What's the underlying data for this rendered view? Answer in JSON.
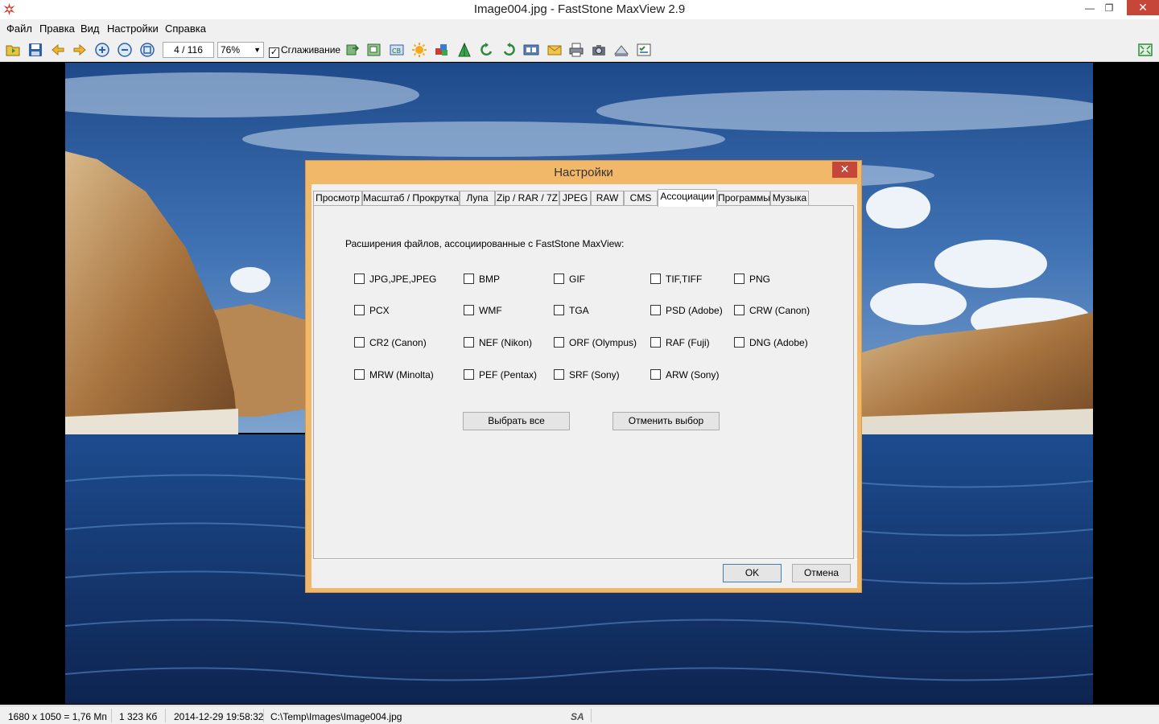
{
  "window": {
    "title": "Image004.jpg - FastStone MaxView 2.9",
    "min_glyph": "—",
    "max_glyph": "❐",
    "close_glyph": "✕"
  },
  "menu": {
    "items": [
      "Файл",
      "Правка",
      "Вид",
      "Настройки",
      "Справка"
    ]
  },
  "toolbar": {
    "page_counter": "4 / 116",
    "zoom_value": "76%",
    "smoothing_label": "Сглаживание",
    "smoothing_checked": true,
    "checkmark": "✓",
    "caret": "▼",
    "icons": [
      "open-folder-icon",
      "save-icon",
      "previous-icon",
      "next-icon",
      "zoom-in-icon",
      "zoom-out-icon",
      "actual-size-icon",
      "copy-to-icon",
      "resize-icon",
      "crop-icon",
      "brightness-icon",
      "colors-icon",
      "sharpen-icon",
      "rotate-left-icon",
      "rotate-right-icon",
      "slideshow-icon",
      "email-icon",
      "print-icon",
      "capture-icon",
      "wallpaper-icon",
      "properties-icon",
      "fit-screen-icon"
    ]
  },
  "status": {
    "dimensions": "1680 x 1050 = 1,76 Мп",
    "filesize": "1 323 Кб",
    "datetime": "2014-12-29 19:58:32",
    "path": "C:\\Temp\\Images\\Image004.jpg",
    "badge": "SA"
  },
  "dialog": {
    "title": "Настройки",
    "close_glyph": "✕",
    "tabs": [
      "Просмотр",
      "Масштаб / Прокрутка",
      "Лупа",
      "Zip / RAR / 7Z",
      "JPEG",
      "RAW",
      "CMS",
      "Ассоциации",
      "Программы",
      "Музыка"
    ],
    "active_tab": "Ассоциации",
    "panel_label": "Расширения файлов, ассоциированные с FastStone MaxView:",
    "extensions": [
      [
        "JPG,JPE,JPEG",
        "BMP",
        "GIF",
        "TIF,TIFF",
        "PNG"
      ],
      [
        "PCX",
        "WMF",
        "TGA",
        "PSD (Adobe)",
        "CRW (Canon)"
      ],
      [
        "CR2 (Canon)",
        "NEF (Nikon)",
        "ORF (Olympus)",
        "RAF (Fuji)",
        "DNG (Adobe)"
      ],
      [
        "MRW (Minolta)",
        "PEF (Pentax)",
        "SRF (Sony)",
        "ARW (Sony)"
      ]
    ],
    "select_all": "Выбрать все",
    "deselect_all": "Отменить выбор",
    "ok": "OK",
    "cancel": "Отмена"
  },
  "colors": {
    "dialog_frame": "#f2b869",
    "close_red": "#c7463a",
    "focus_blue": "#3c7fb1"
  }
}
